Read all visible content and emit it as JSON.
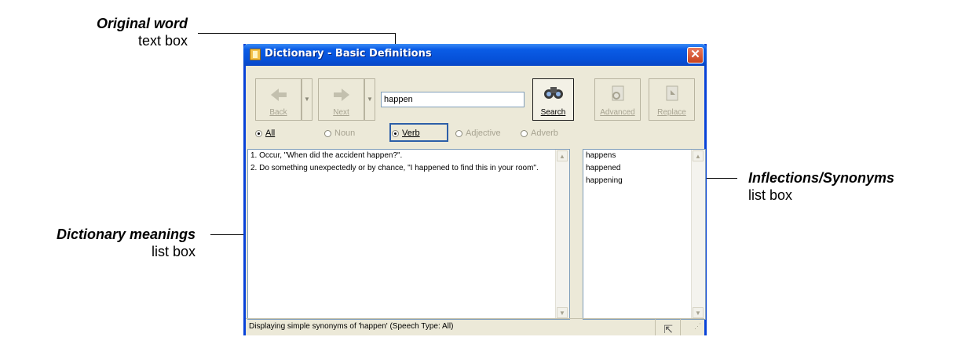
{
  "annotations": {
    "original_word": {
      "title": "Original word",
      "subtitle": "text box"
    },
    "dictionary_meanings": {
      "title": "Dictionary meanings",
      "subtitle": "list box"
    },
    "inflections": {
      "title": "Inflections/Synonyms",
      "subtitle": "list box"
    }
  },
  "window": {
    "title": "Dictionary - Basic Definitions",
    "close_label": "✕"
  },
  "toolbar": {
    "back_label": "Back",
    "next_label": "Next",
    "search_label": "Search",
    "advanced_label": "Advanced",
    "replace_label": "Replace",
    "word_value": "happen"
  },
  "speech_types": [
    {
      "label": "All",
      "selected": true
    },
    {
      "label": "Noun",
      "selected": false
    },
    {
      "label": "Verb",
      "selected": false
    },
    {
      "label": "Adjective",
      "selected": false
    },
    {
      "label": "Adverb",
      "selected": false
    }
  ],
  "meanings": [
    "1. Occur, \"When did the accident happen?\".",
    "2. Do something unexpectedly or by chance, \"I happened to find this in your room\"."
  ],
  "inflections": [
    "happens",
    "happened",
    "happening"
  ],
  "status": {
    "text": "Displaying simple synonyms of 'happen' (Speech Type: All)"
  },
  "icons": {
    "back": "arrow-left-icon",
    "next": "arrow-right-icon",
    "search": "binoculars-icon",
    "advanced": "document-search-icon",
    "replace": "replace-icon"
  }
}
